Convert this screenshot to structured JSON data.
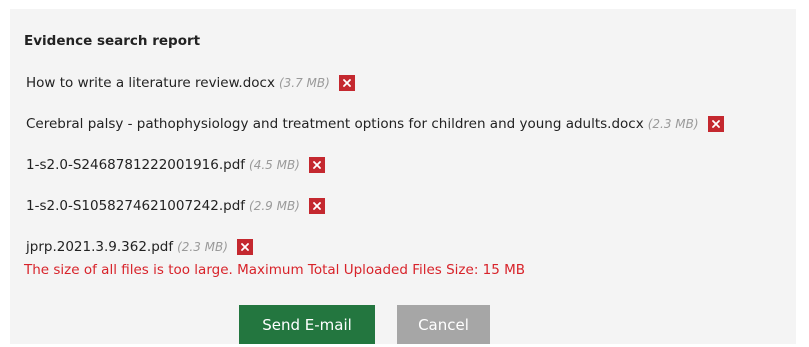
{
  "report": {
    "title": "Evidence search report"
  },
  "files": [
    {
      "name": "How to write a literature review.docx",
      "size": "(3.7 MB)"
    },
    {
      "name": "Cerebral palsy - pathophysiology and treatment options for children and young adults.docx",
      "size": "(2.3 MB)"
    },
    {
      "name": "1-s2.0-S2468781222001916.pdf",
      "size": "(4.5 MB)"
    },
    {
      "name": "1-s2.0-S1058274621007242.pdf",
      "size": "(2.9 MB)"
    },
    {
      "name": "jprp.2021.3.9.362.pdf",
      "size": "(2.3 MB)"
    }
  ],
  "remove_icon": "close-icon",
  "error_message": "The size of all files is too large. Maximum Total Uploaded Files Size: 15 MB",
  "buttons": {
    "send_label": "Send E-mail",
    "cancel_label": "Cancel"
  },
  "colors": {
    "panel_bg": "#f4f4f4",
    "remove_red": "#c4282f",
    "error_red": "#d8232a",
    "send_green": "#23763f",
    "cancel_gray": "#a6a6a6"
  }
}
